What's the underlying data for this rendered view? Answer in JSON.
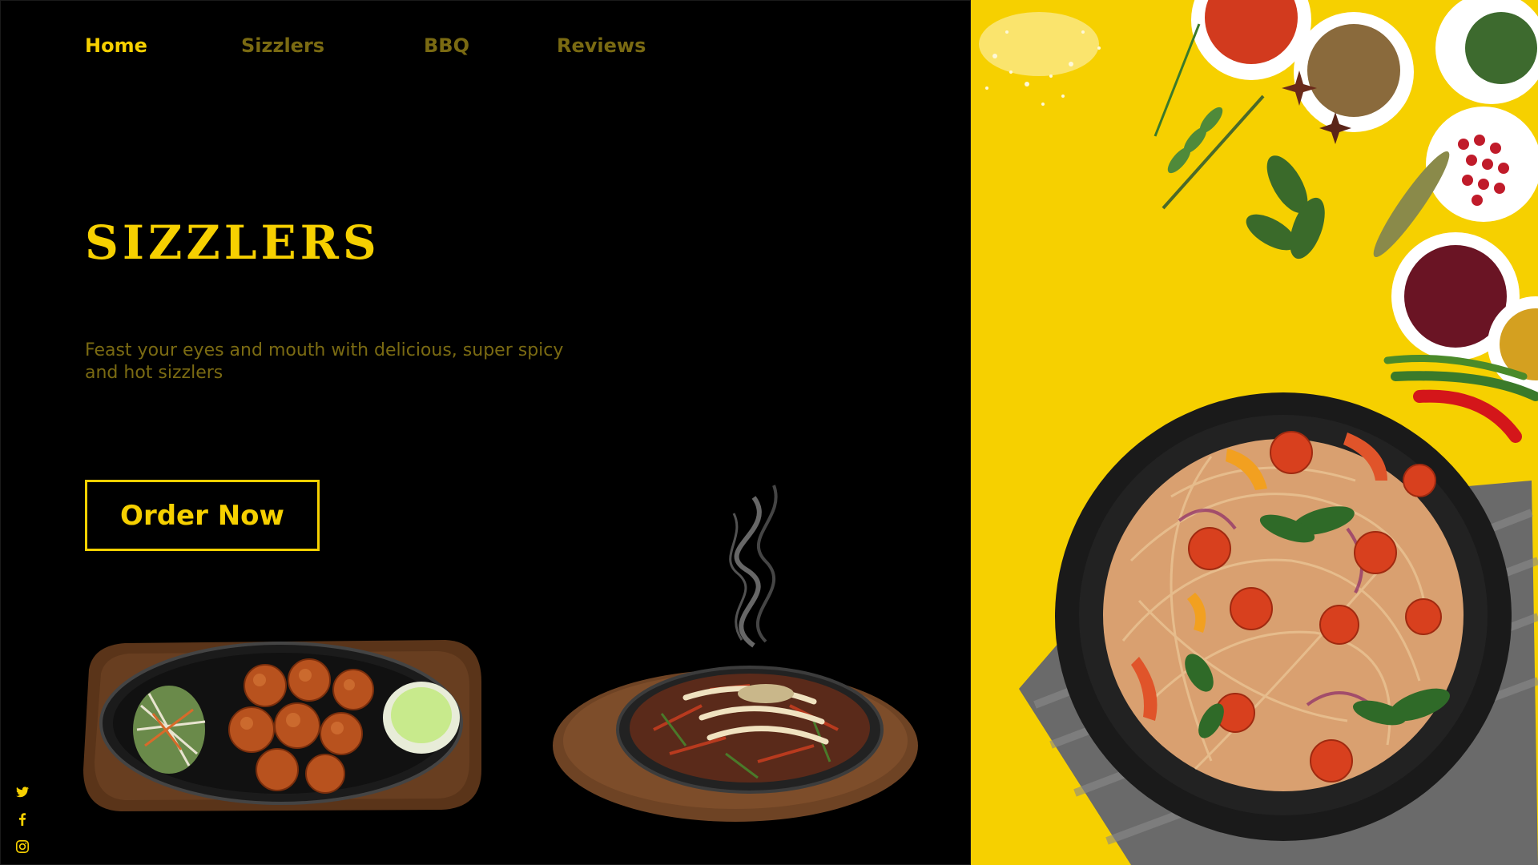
{
  "nav": {
    "items": [
      {
        "label": "Home",
        "active": true
      },
      {
        "label": "Sizzlers",
        "active": false
      },
      {
        "label": "BBQ",
        "active": false
      },
      {
        "label": "Reviews",
        "active": false
      }
    ]
  },
  "hero": {
    "title": "SIZZLERS",
    "subtitle": "Feast your eyes and mouth with delicious, super spicy and hot sizzlers",
    "cta_label": "Order Now"
  },
  "social": {
    "icons": [
      "twitter-icon",
      "facebook-icon",
      "instagram-icon"
    ]
  },
  "colors": {
    "background": "#000000",
    "accent": "#f6d000",
    "muted_text": "#7a6a12"
  }
}
